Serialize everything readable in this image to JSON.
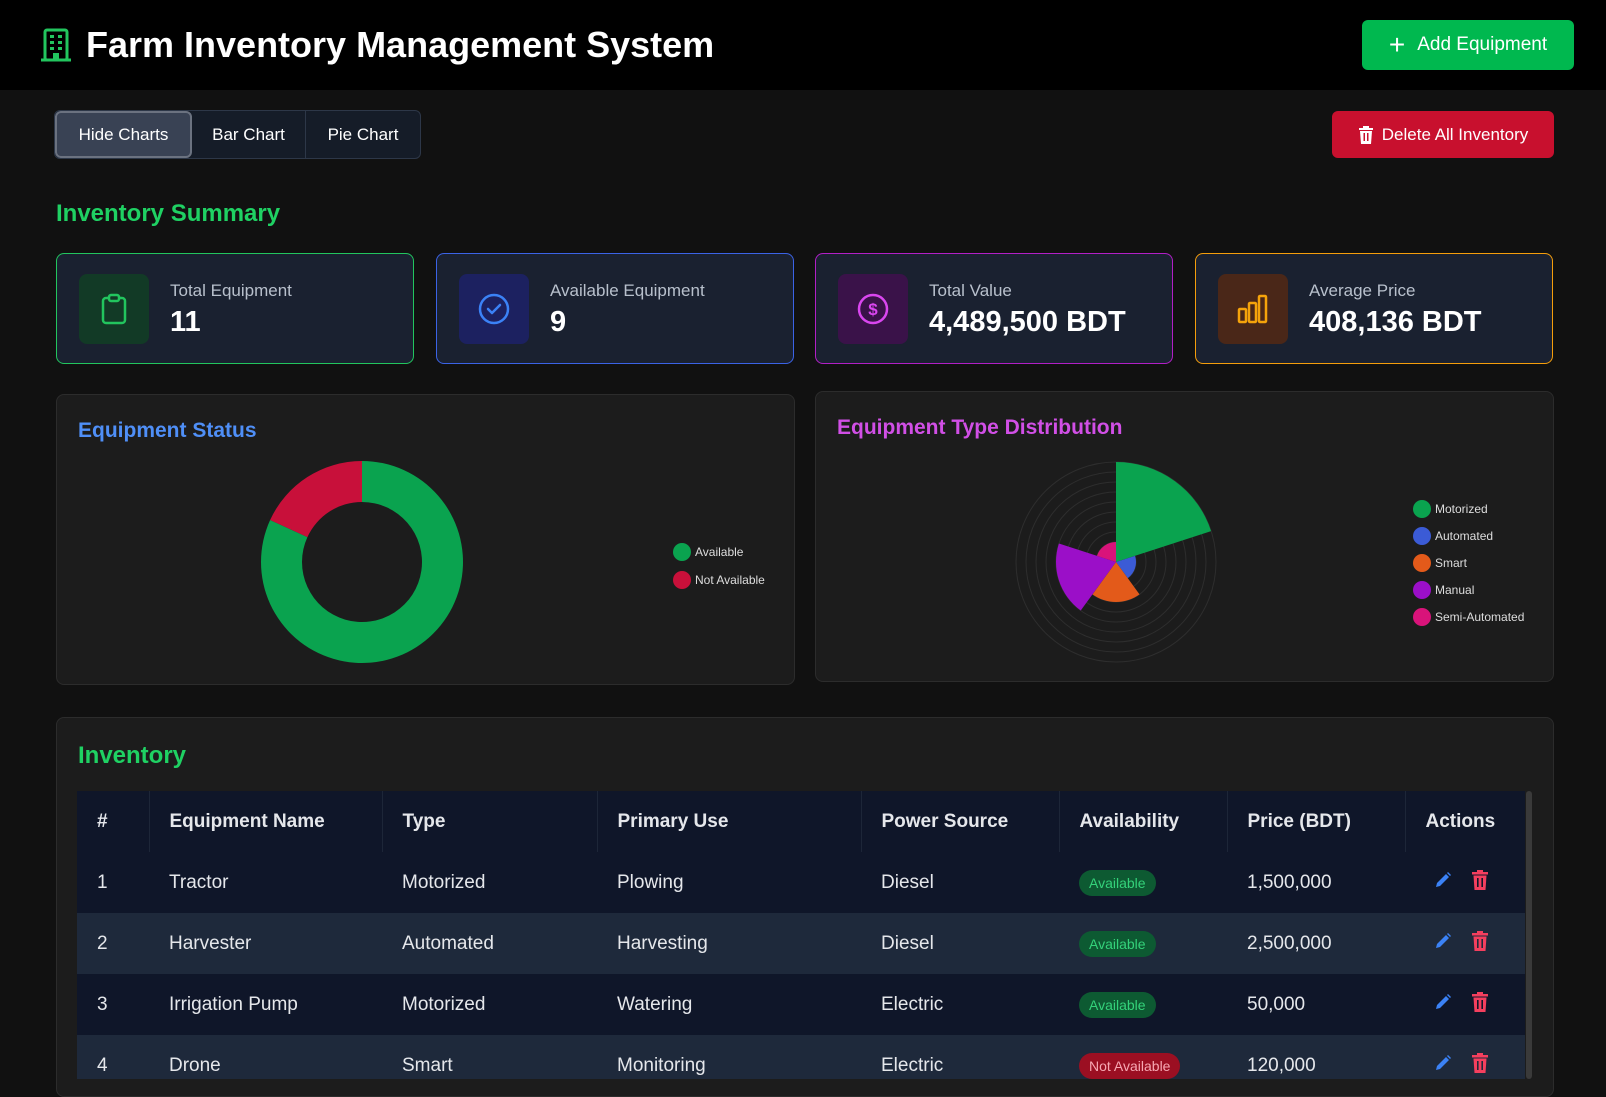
{
  "header": {
    "title": "Farm Inventory Management System",
    "add_label": "Add Equipment",
    "icon": "building-icon"
  },
  "toolbar": {
    "hide_charts": "Hide Charts",
    "bar_chart": "Bar Chart",
    "pie_chart": "Pie Chart",
    "delete_all": "Delete All Inventory"
  },
  "summary": {
    "title": "Inventory Summary",
    "cards": [
      {
        "label": "Total Equipment",
        "value": "11",
        "icon": "clipboard-icon",
        "color": "#22c55e"
      },
      {
        "label": "Available Equipment",
        "value": "9",
        "icon": "check-circle-icon",
        "color": "#3b82f6"
      },
      {
        "label": "Total Value",
        "value": "4,489,500 BDT",
        "icon": "dollar-icon",
        "color": "#c026d3"
      },
      {
        "label": "Average Price",
        "value": "408,136 BDT",
        "icon": "bar-chart-icon",
        "color": "#f59e0b"
      }
    ]
  },
  "chart_data": [
    {
      "type": "pie",
      "title": "Equipment Status",
      "categories": [
        "Available",
        "Not Available"
      ],
      "values": [
        9,
        2
      ],
      "colors": [
        "#0aa34f",
        "#c8103a"
      ],
      "donut": true,
      "legend": "right"
    },
    {
      "type": "pie",
      "title": "Equipment Type Distribution",
      "categories": [
        "Motorized",
        "Automated",
        "Smart",
        "Manual",
        "Semi-Automated"
      ],
      "values": [
        5,
        1,
        2,
        3,
        1
      ],
      "colors": [
        "#0aa34f",
        "#3b5bd6",
        "#e35a1a",
        "#9b0fc8",
        "#d9137a"
      ],
      "polar_area": true,
      "legend": "right"
    }
  ],
  "inventory": {
    "title": "Inventory",
    "columns": [
      "#",
      "Equipment Name",
      "Type",
      "Primary Use",
      "Power Source",
      "Availability",
      "Price (BDT)",
      "Actions"
    ],
    "rows": [
      {
        "num": "1",
        "name": "Tractor",
        "type": "Motorized",
        "use": "Plowing",
        "power": "Diesel",
        "availability": "Available",
        "price": "1,500,000"
      },
      {
        "num": "2",
        "name": "Harvester",
        "type": "Automated",
        "use": "Harvesting",
        "power": "Diesel",
        "availability": "Available",
        "price": "2,500,000"
      },
      {
        "num": "3",
        "name": "Irrigation Pump",
        "type": "Motorized",
        "use": "Watering",
        "power": "Electric",
        "availability": "Available",
        "price": "50,000"
      },
      {
        "num": "4",
        "name": "Drone",
        "type": "Smart",
        "use": "Monitoring",
        "power": "Electric",
        "availability": "Not Available",
        "price": "120,000"
      }
    ]
  }
}
